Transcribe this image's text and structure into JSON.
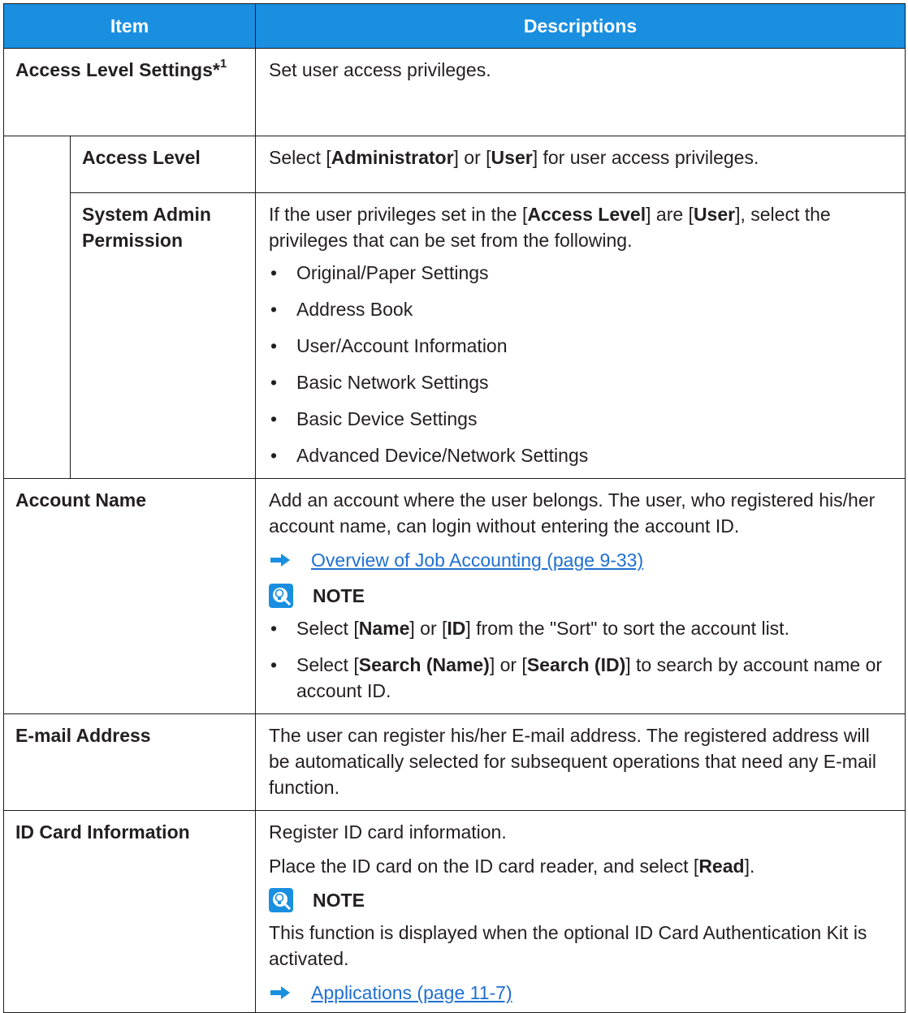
{
  "header": {
    "item": "Item",
    "descriptions": "Descriptions"
  },
  "rows": {
    "access_level_settings": {
      "label": "Access Level Settings*",
      "sup": "1",
      "desc": "Set user access privileges."
    },
    "access_level": {
      "label": "Access Level",
      "desc": {
        "pre": "Select [",
        "b1": "Administrator",
        "mid": "] or [",
        "b2": "User",
        "post": "] for user access privileges."
      }
    },
    "system_admin": {
      "label": "System Admin Permission",
      "desc": {
        "pre": "If the user privileges set in the [",
        "b1": "Access Level",
        "mid": "] are [",
        "b2": "User",
        "post": "], select the privileges that can be set from the following."
      },
      "bullets": [
        "Original/Paper Settings",
        "Address Book",
        "User/Account Information",
        "Basic Network Settings",
        "Basic Device Settings",
        "Advanced Device/Network Settings"
      ]
    },
    "account_name": {
      "label": "Account Name",
      "desc": "Add an account where the user belongs. The user, who registered his/her account name, can login without entering the account ID.",
      "link": "Overview of Job Accounting (page 9-33)",
      "note_title": "NOTE",
      "note_bullet1": {
        "pre": "Select [",
        "b1": "Name",
        "mid": "] or [",
        "b2": "ID",
        "post": "] from the \"Sort\" to sort the account list."
      },
      "note_bullet2": {
        "pre": "Select [",
        "b1": "Search (Name)",
        "mid": "] or [",
        "b2": "Search (ID)",
        "post": "] to search by account name or account ID."
      }
    },
    "email_address": {
      "label": "E-mail Address",
      "desc": "The user can register his/her E-mail address. The registered address will be automatically selected for subsequent operations that need any E-mail function."
    },
    "id_card": {
      "label": "ID Card Information",
      "desc1": "Register ID card information.",
      "desc2": {
        "pre": "Place the ID card on the ID card reader, and select [",
        "b1": "Read",
        "post": "]."
      },
      "note_title": "NOTE",
      "note_text": "This function is displayed when the optional ID Card Authentication Kit is activated.",
      "link": "Applications (page 11-7)"
    }
  },
  "colors": {
    "header_bg": "#1a8fe0",
    "link": "#1f6fd1",
    "arrow": "#1a8fe0"
  }
}
